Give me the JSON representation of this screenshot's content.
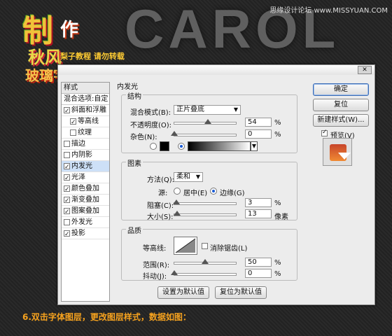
{
  "background": {
    "big_text": "CAROL",
    "logo_lines": [
      "制",
      "作",
      "秋风",
      "玻璃字"
    ],
    "subtitle": "梨子教程 请勿转载",
    "watermark": "思缘设计论坛 www.MISSYUAN.COM",
    "caption": "6.双击字体图层，更改图层样式，数据如图："
  },
  "dialog": {
    "close_glyph": "✕",
    "sidebar": {
      "header": "样式",
      "blend_options": "混合选项:自定",
      "items": [
        {
          "label": "斜面和浮雕",
          "checked": true,
          "indent": false,
          "selected": false
        },
        {
          "label": "等高线",
          "checked": true,
          "indent": true,
          "selected": false
        },
        {
          "label": "纹理",
          "checked": false,
          "indent": true,
          "selected": false
        },
        {
          "label": "描边",
          "checked": false,
          "indent": false,
          "selected": false
        },
        {
          "label": "内阴影",
          "checked": false,
          "indent": false,
          "selected": false
        },
        {
          "label": "内发光",
          "checked": true,
          "indent": false,
          "selected": true
        },
        {
          "label": "光泽",
          "checked": true,
          "indent": false,
          "selected": false
        },
        {
          "label": "颜色叠加",
          "checked": true,
          "indent": false,
          "selected": false
        },
        {
          "label": "渐变叠加",
          "checked": true,
          "indent": false,
          "selected": false
        },
        {
          "label": "图案叠加",
          "checked": true,
          "indent": false,
          "selected": false
        },
        {
          "label": "外发光",
          "checked": false,
          "indent": false,
          "selected": false
        },
        {
          "label": "投影",
          "checked": true,
          "indent": false,
          "selected": false
        }
      ]
    },
    "panel_title": "内发光",
    "structure": {
      "legend": "结构",
      "blend_mode_label": "混合模式(B):",
      "blend_mode_value": "正片叠底",
      "opacity_label": "不透明度(O):",
      "opacity_value": "54",
      "opacity_unit": "%",
      "opacity_level": 0.54,
      "noise_label": "杂色(N):",
      "noise_value": "0",
      "noise_unit": "%",
      "noise_level": 0.0
    },
    "elements": {
      "legend": "图素",
      "method_label": "方法(Q):",
      "method_value": "柔和",
      "source_label": "源:",
      "source_center": "居中(E)",
      "source_edge": "边缘(G)",
      "choke_label": "阻塞(C):",
      "choke_value": "3",
      "choke_unit": "%",
      "choke_level": 0.03,
      "size_label": "大小(S):",
      "size_value": "13",
      "size_unit": "像素",
      "size_level": 0.05
    },
    "quality": {
      "legend": "品质",
      "contour_label": "等高线:",
      "antialias_label": "消除锯齿(L)",
      "range_label": "范围(R):",
      "range_value": "50",
      "range_unit": "%",
      "range_level": 0.5,
      "jitter_label": "抖动(J):",
      "jitter_value": "0",
      "jitter_unit": "%",
      "jitter_level": 0.0
    },
    "buttons": {
      "set_default": "设置为默认值",
      "reset_default": "复位为默认值",
      "ok": "确定",
      "reset": "复位",
      "new_style": "新建样式(W)...",
      "preview_label": "预览(V)"
    }
  }
}
